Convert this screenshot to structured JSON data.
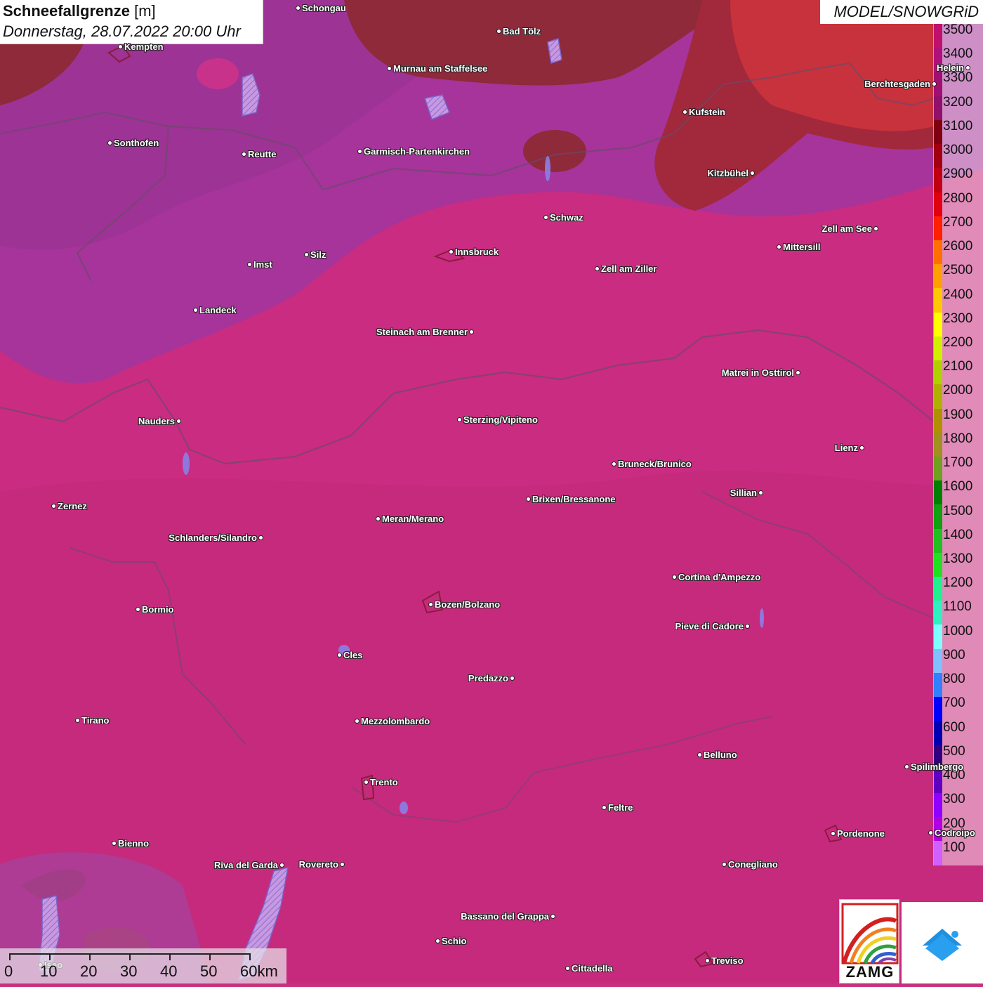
{
  "title": {
    "main": "Schneefallgrenze",
    "unit": "[m]",
    "datetime": "Donnerstag, 28.07.2022 20:00 Uhr"
  },
  "model_label": "MODEL/SNOWGRiD",
  "legend": {
    "labels": [
      "3500",
      "3400",
      "3300",
      "3200",
      "3100",
      "3000",
      "2900",
      "2800",
      "2700",
      "2600",
      "2500",
      "2400",
      "2300",
      "2200",
      "2100",
      "2000",
      "1900",
      "1800",
      "1700",
      "1600",
      "1500",
      "1400",
      "1300",
      "1200",
      "1100",
      "1000",
      "900",
      "800",
      "700",
      "600",
      "500",
      "400",
      "300",
      "200",
      "100"
    ],
    "colors": [
      "#c0106e",
      "#b0107a",
      "#a01070",
      "#90106a",
      "#800010",
      "#a00010",
      "#c00010",
      "#e00010",
      "#ff2000",
      "#ff7000",
      "#ffa000",
      "#ffc800",
      "#ffff00",
      "#d0f000",
      "#b0d000",
      "#b0b000",
      "#b09000",
      "#a09020",
      "#70a020",
      "#008000",
      "#10a010",
      "#20c020",
      "#20e020",
      "#20f090",
      "#30f0c0",
      "#80ffff",
      "#80c0ff",
      "#3080ff",
      "#0000ff",
      "#0000b0",
      "#300080",
      "#6000c0",
      "#9000ff",
      "#b000e0",
      "#d060ff"
    ]
  },
  "scale_bar": {
    "labels": [
      "0",
      "10",
      "20",
      "30",
      "40",
      "50",
      "60km"
    ]
  },
  "logos": {
    "zamg": "ZAMG"
  },
  "cities": [
    {
      "name": "Schongau"
    },
    {
      "name": "Bad Tölz"
    },
    {
      "name": "Kempten"
    },
    {
      "name": "Murnau am Staffelsee"
    },
    {
      "name": "Helein"
    },
    {
      "name": "Berchtesgaden"
    },
    {
      "name": "Kufstein"
    },
    {
      "name": "Sonthofen"
    },
    {
      "name": "Reutte"
    },
    {
      "name": "Garmisch-Partenkirchen"
    },
    {
      "name": "Kitzbühel"
    },
    {
      "name": "Schwaz"
    },
    {
      "name": "Zell am See"
    },
    {
      "name": "Mittersill"
    },
    {
      "name": "Innsbruck"
    },
    {
      "name": "Silz"
    },
    {
      "name": "Imst"
    },
    {
      "name": "Zell am Ziller"
    },
    {
      "name": "Landeck"
    },
    {
      "name": "Steinach am Brenner"
    },
    {
      "name": "Matrei in Osttirol"
    },
    {
      "name": "Nauders"
    },
    {
      "name": "Sterzing/Vipiteno"
    },
    {
      "name": "Lienz"
    },
    {
      "name": "Bruneck/Brunico"
    },
    {
      "name": "Sillian"
    },
    {
      "name": "Brixen/Bressanone"
    },
    {
      "name": "Zernez"
    },
    {
      "name": "Meran/Merano"
    },
    {
      "name": "Schlanders/Silandro"
    },
    {
      "name": "Cortina d'Ampezzo"
    },
    {
      "name": "Bozen/Bolzano"
    },
    {
      "name": "Bormio"
    },
    {
      "name": "Pieve di Cadore"
    },
    {
      "name": "Cles"
    },
    {
      "name": "Predazzo"
    },
    {
      "name": "Tirano"
    },
    {
      "name": "Mezzolombardo"
    },
    {
      "name": "Belluno"
    },
    {
      "name": "Spilimbergo"
    },
    {
      "name": "Trento"
    },
    {
      "name": "Feltre"
    },
    {
      "name": "Pordenone"
    },
    {
      "name": "Codroipo"
    },
    {
      "name": "Bienno"
    },
    {
      "name": "Riva del Garda"
    },
    {
      "name": "Rovereto"
    },
    {
      "name": "Conegliano"
    },
    {
      "name": "Bassano del Grappa"
    },
    {
      "name": "Schio"
    },
    {
      "name": "Treviso"
    },
    {
      "name": "Cittadella"
    },
    {
      "name": "Iseo"
    }
  ]
}
